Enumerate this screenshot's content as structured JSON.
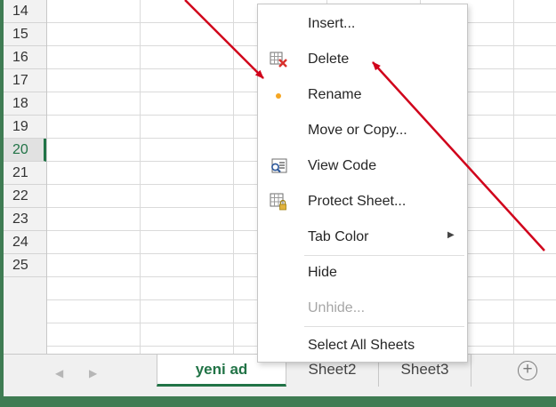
{
  "spreadsheet": {
    "rows": [
      "14",
      "15",
      "16",
      "17",
      "18",
      "19",
      "20",
      "21",
      "22",
      "23",
      "24",
      "25"
    ],
    "active_row": "20"
  },
  "context_menu": {
    "items": [
      {
        "label": "Insert...",
        "icon": "none",
        "enabled": true
      },
      {
        "label": "Delete",
        "icon": "delete-sheet-icon",
        "enabled": true
      },
      {
        "label": "Rename",
        "icon": "orange-dot-icon",
        "enabled": true
      },
      {
        "label": "Move or Copy...",
        "icon": "none",
        "enabled": true
      },
      {
        "label": "View Code",
        "icon": "view-code-icon",
        "enabled": true
      },
      {
        "label": "Protect Sheet...",
        "icon": "protect-sheet-icon",
        "enabled": true
      },
      {
        "label": "Tab Color",
        "icon": "none",
        "enabled": true,
        "submenu": true
      },
      {
        "label": "Hide",
        "icon": "none",
        "enabled": true
      },
      {
        "label": "Unhide...",
        "icon": "none",
        "enabled": false
      },
      {
        "label": "Select All Sheets",
        "icon": "none",
        "enabled": true
      }
    ]
  },
  "sheet_tabs": {
    "tabs": [
      {
        "label": "yeni ad",
        "active": true
      },
      {
        "label": "Sheet2",
        "active": false
      },
      {
        "label": "Sheet3",
        "active": false
      }
    ],
    "add_symbol": "+"
  },
  "colors": {
    "excel_green": "#217346",
    "frame_green": "#3f7c53",
    "annotation_red": "#d0021b",
    "rename_dot": "#f5a623"
  }
}
